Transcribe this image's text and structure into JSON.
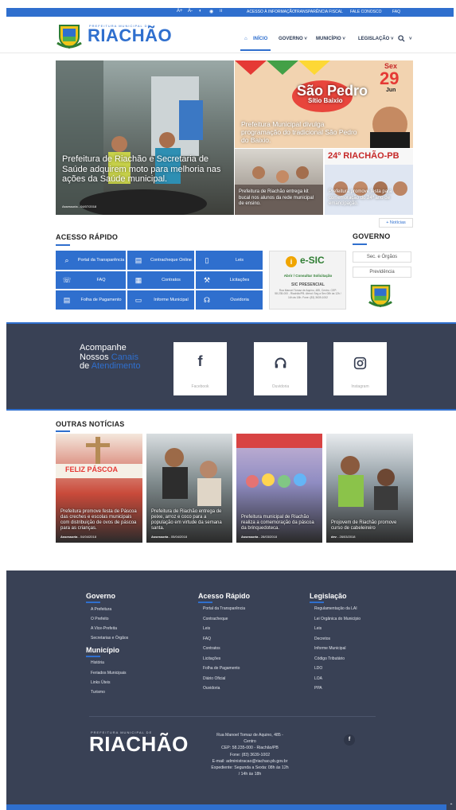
{
  "topbar": {
    "access_icons": [
      "A+",
      "A-",
      "contrast-icon",
      "eye-icon",
      "font-icon"
    ],
    "links": [
      "ACESSO À INFORMAÇÃO",
      "TRANSPARÊNCIA FISCAL",
      "FALE CONOSCO",
      "FAQ"
    ]
  },
  "header": {
    "logo_small": "PREFEITURA MUNICIPAL DE",
    "logo_text": "RIACHÃO",
    "nav": [
      "INÍCIO",
      "GOVERNO",
      "MUNICÍPIO",
      "LEGISLAÇÃO"
    ],
    "home_icon": "home-icon",
    "search_icon": "search-icon"
  },
  "slider": {
    "main": {
      "caption": "Prefeitura de Riachão e Secretaria de Saúde adquirem moto para melhoria nas ações da Saúde municipal.",
      "meta": "Assessoria - 04/07/2018"
    },
    "top_right": {
      "caption": "Prefeitura Municipal divulga programação do tradicional São Pedro do Baixio.",
      "poster_title": "São Pedro",
      "poster_sub": "Sítio Baixio",
      "poster_day": "Sex",
      "poster_date": "29",
      "poster_month": "Jun"
    },
    "bottom_left": {
      "caption": "Prefeitura de Riachão entrega kit bucal nos alunos da rede municipal de ensino."
    },
    "bottom_right": {
      "caption": "Prefeitura promove festa para comemoração do 24º ano de emancipação.",
      "poster_title": "24º RIACHÃO-PB"
    },
    "more_link": "+ Notícias"
  },
  "acesso": {
    "title": "ACESSO RÁPIDO",
    "buttons": [
      {
        "label": "Portal da Transparência",
        "icon": "search-doc-icon"
      },
      {
        "label": "Contracheque Online",
        "icon": "paycheck-icon"
      },
      {
        "label": "Leis",
        "icon": "document-icon"
      },
      {
        "label": "FAQ",
        "icon": "chat-icon"
      },
      {
        "label": "Contratos",
        "icon": "contract-icon"
      },
      {
        "label": "Licitações",
        "icon": "gavel-icon"
      },
      {
        "label": "Folha de Pagamento",
        "icon": "payroll-icon"
      },
      {
        "label": "Informe Municipal",
        "icon": "book-icon"
      },
      {
        "label": "Ouvidoria",
        "icon": "headset-icon"
      }
    ],
    "esic": {
      "logo": "e-SIC",
      "tagline": "Abrir / Consultar Solicitação",
      "presencial": "SIC PRESENCIAL",
      "address": "Rua Manoel Tomaz de Aquino, 485, Centro. CEP: 58.235-000 - Riachão/PB. Atend: Seg a Sex 08h às 12h / 14h às 18h. Fone: (83) 3639-1002"
    }
  },
  "governo": {
    "title": "GOVERNO",
    "buttons": [
      "Sec. e Órgãos",
      "Previdência"
    ]
  },
  "canais": {
    "line1": "Acompanhe",
    "line2a": "Nossos ",
    "line2b": "Canais",
    "line3a": "de ",
    "line3b": "Atendimento",
    "cards": [
      {
        "icon": "f",
        "label": "Facebook"
      },
      {
        "icon": "headset-icon",
        "label": "Ouvidoria"
      },
      {
        "icon": "instagram-icon",
        "label": "Instagram"
      }
    ]
  },
  "outras": {
    "title": "OUTRAS NOTÍCIAS",
    "items": [
      {
        "caption": "Prefeitura promove festa de Páscoa das creches e escolas municipais com distribuição de ovos de páscoa para as crianças.",
        "author": "Assessoria",
        "date": "04/04/2018",
        "banner": "FELIZ PÁSCOA"
      },
      {
        "caption": "Prefeitura de Riachão entrega de peixe, arroz e coco para a população em virtude da semana santa.",
        "author": "Assessoria",
        "date": "05/04/2018"
      },
      {
        "caption": "Prefeitura municipal de Riachão realiza a comemoração da páscoa da brinquedoteca.",
        "author": "Assessoria",
        "date": "28/03/2018"
      },
      {
        "caption": "Projovem de Riachão promove curso de cabeleireiro",
        "author": "dev",
        "date": "26/03/2018"
      }
    ]
  },
  "footer": {
    "governo": {
      "title": "Governo",
      "links": [
        "A Prefeitura",
        "O Prefeito",
        "A Vice-Prefeita",
        "Secretarias e Órgãos"
      ]
    },
    "municipio": {
      "title": "Município",
      "links": [
        "História",
        "Feriados Municipais",
        "Links Úteis",
        "Turismo"
      ]
    },
    "acesso": {
      "title": "Acesso Rápido",
      "links": [
        "Portal da Transparência",
        "Contracheque",
        "Leis",
        "FAQ",
        "Contratos",
        "Licitações",
        "Folha de Pagamento",
        "Diário Oficial",
        "Ouvidoria"
      ]
    },
    "legislacao": {
      "title": "Legislação",
      "links": [
        "Regulamentação da LAI",
        "Lei Orgânica do Município",
        "Leis",
        "Decretos",
        "Informe Municipal",
        "Código Tributário",
        "LDO",
        "LOA",
        "PPA"
      ]
    },
    "logo_small": "PREFEITURA MUNICIPAL DE",
    "logo_text": "RIACHÃO",
    "address": [
      "Rua Manoel Tomaz de Aquino, 485 -",
      "Centro",
      "CEP: 58.235-000 - Riachão/PB",
      "Fone: (83) 3639-1002",
      "E-mail: administracao@riachao.pb.gov.br",
      "Expediente: Segunda a Sexta: 08h às 12h",
      "/ 14h às 18h"
    ],
    "social_icon": "f"
  },
  "colors": {
    "primary": "#2f6fce",
    "dark": "#394155",
    "white": "#ffffff"
  }
}
